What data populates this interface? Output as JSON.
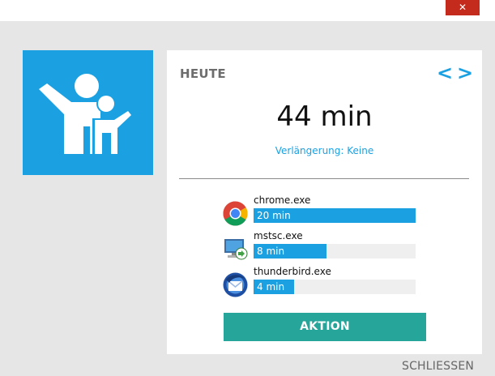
{
  "window": {
    "close_glyph": "✕"
  },
  "logo": {
    "icon": "parent-child-icon",
    "color": "#1ba1e2"
  },
  "card": {
    "title": "HEUTE",
    "prev_label": "<",
    "next_label": ">",
    "total_time": "44 min",
    "extension_text": "Verlängerung: Keine"
  },
  "apps": [
    {
      "name": "chrome.exe",
      "time": "20 min",
      "fraction": 1.0,
      "icon": "chrome-icon"
    },
    {
      "name": "mstsc.exe",
      "time": "8 min",
      "fraction": 0.45,
      "icon": "remote-desktop-icon"
    },
    {
      "name": "thunderbird.exe",
      "time": "4 min",
      "fraction": 0.25,
      "icon": "thunderbird-icon"
    }
  ],
  "action_label": "AKTION",
  "close_label": "SCHLIESSEN",
  "colors": {
    "accent": "#1ba1e2",
    "action": "#26a69a",
    "close_button": "#c42b1c"
  }
}
